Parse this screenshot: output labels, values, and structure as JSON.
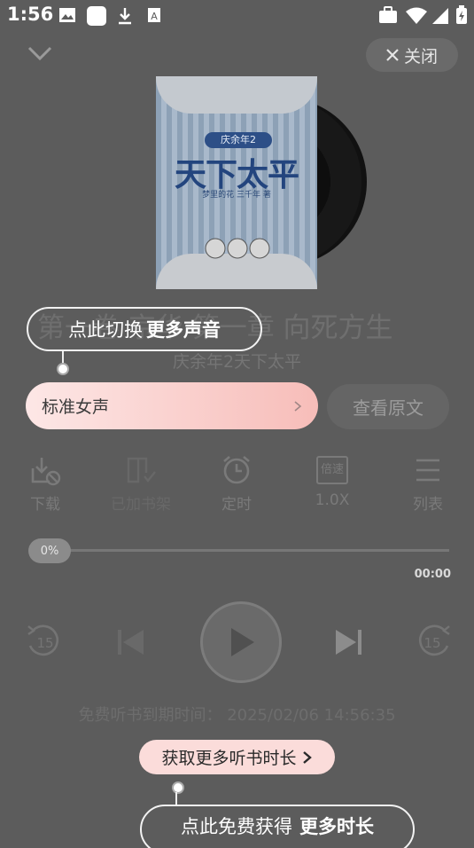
{
  "status_bar": {
    "time": "1:56"
  },
  "header": {
    "close_label": "关闭"
  },
  "cover": {
    "series_label": "庆余年2",
    "title": "天下太平",
    "subtitle": "梦里的花 三千年 著"
  },
  "track": {
    "chapter_title": "第一卷 京华 第一章 向死方生",
    "book_title": "庆余年2天下太平"
  },
  "tooltip_voice": {
    "prefix": "点此切换",
    "emphasis": "更多声音"
  },
  "voice_selector": {
    "label": "标准女声"
  },
  "view_original": {
    "label": "查看原文"
  },
  "tools": [
    {
      "icon": "download-icon",
      "label": "下载"
    },
    {
      "icon": "bookshelf-icon",
      "label": "已加书架"
    },
    {
      "icon": "alarm-clock-icon",
      "label": "定时"
    },
    {
      "icon": "speed-icon",
      "icon_text": "倍速",
      "label": "1.0X"
    },
    {
      "icon": "list-icon",
      "label": "列表"
    }
  ],
  "progress": {
    "percent_label": "0%",
    "value": 0,
    "duration": "00:00"
  },
  "controls": {
    "rewind_seconds": "15",
    "forward_seconds": "15"
  },
  "expiry": {
    "text": "免费听书到期时间：  2025/02/06 14:56:35"
  },
  "more_time_button": {
    "label": "获取更多听书时长"
  },
  "tooltip_time": {
    "prefix": "点此免费获得",
    "emphasis": "更多时长"
  },
  "colors": {
    "accent_pink": "#f7bdb9",
    "overlay": "#5c5c5c"
  }
}
